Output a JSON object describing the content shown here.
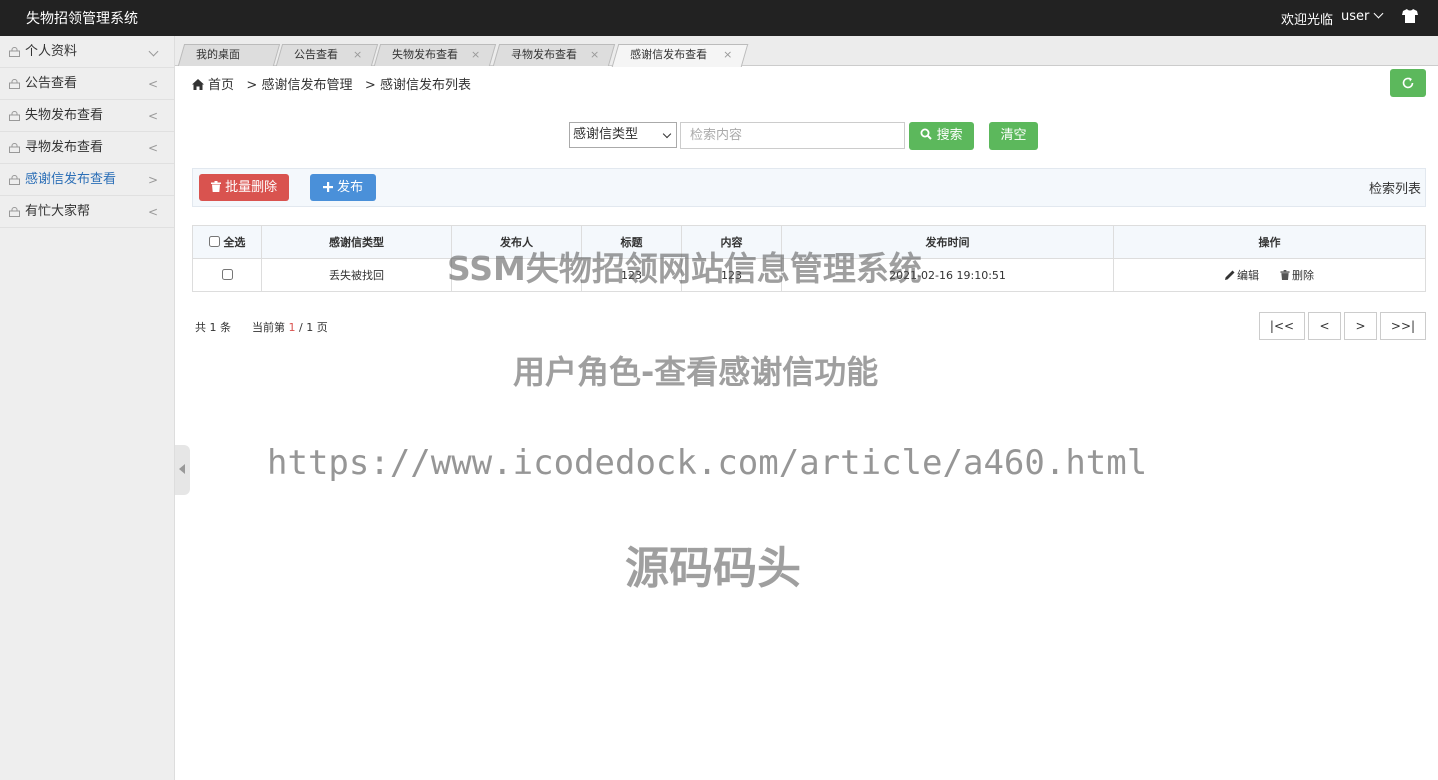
{
  "app": {
    "title": "失物招领管理系统",
    "welcome": "欢迎光临",
    "user": "user"
  },
  "sidebar": {
    "items": [
      {
        "label": "个人资料",
        "arrow": ""
      },
      {
        "label": "公告查看",
        "arrow": "<"
      },
      {
        "label": "失物发布查看",
        "arrow": "<"
      },
      {
        "label": "寻物发布查看",
        "arrow": "<"
      },
      {
        "label": "感谢信发布查看",
        "arrow": ">"
      },
      {
        "label": "有忙大家帮",
        "arrow": "<"
      }
    ],
    "active_index": 4
  },
  "tabs": [
    {
      "label": "我的桌面",
      "close": ""
    },
    {
      "label": "公告查看",
      "close": "×"
    },
    {
      "label": "失物发布查看",
      "close": "×"
    },
    {
      "label": "寻物发布查看",
      "close": "×"
    },
    {
      "label": "感谢信发布查看",
      "close": "×"
    }
  ],
  "breadcrumb": {
    "home": "首页",
    "sep": ">",
    "level1": "感谢信发布管理",
    "level2": "感谢信发布列表"
  },
  "search": {
    "select_value": "感谢信类型",
    "placeholder": "检索内容",
    "search_label": "搜索",
    "clear_label": "清空"
  },
  "toolbar": {
    "batch_delete": "批量删除",
    "publish": "发布",
    "list_label": "检索列表"
  },
  "table": {
    "headers": [
      "全选",
      "感谢信类型",
      "发布人",
      "标题",
      "内容",
      "发布时间",
      "操作"
    ],
    "rows": [
      {
        "type": "丢失被找回",
        "publisher": "",
        "title": "123",
        "content": "123",
        "time": "2021-02-16 19:10:51",
        "edit": "编辑",
        "delete": "删除"
      }
    ]
  },
  "pagination": {
    "total_prefix": "共",
    "total": "1",
    "total_suffix": "条",
    "current_prefix": "当前第",
    "current": "1",
    "slash": "/",
    "pages": "1",
    "pages_suffix": "页",
    "first": "|<<",
    "prev": "<",
    "next": ">",
    "last": ">>|"
  },
  "watermark": {
    "line1": "SSM失物招领网站信息管理系统",
    "line2": "用户角色-查看感谢信功能",
    "line3": "https://www.icodedock.com/article/a460.html",
    "line4": "源码码头"
  },
  "colors": {
    "topbar": "#222222",
    "green": "#5cb85c",
    "red": "#d9534f",
    "blue": "#4a90d9",
    "active_link": "#2c6fb7"
  }
}
